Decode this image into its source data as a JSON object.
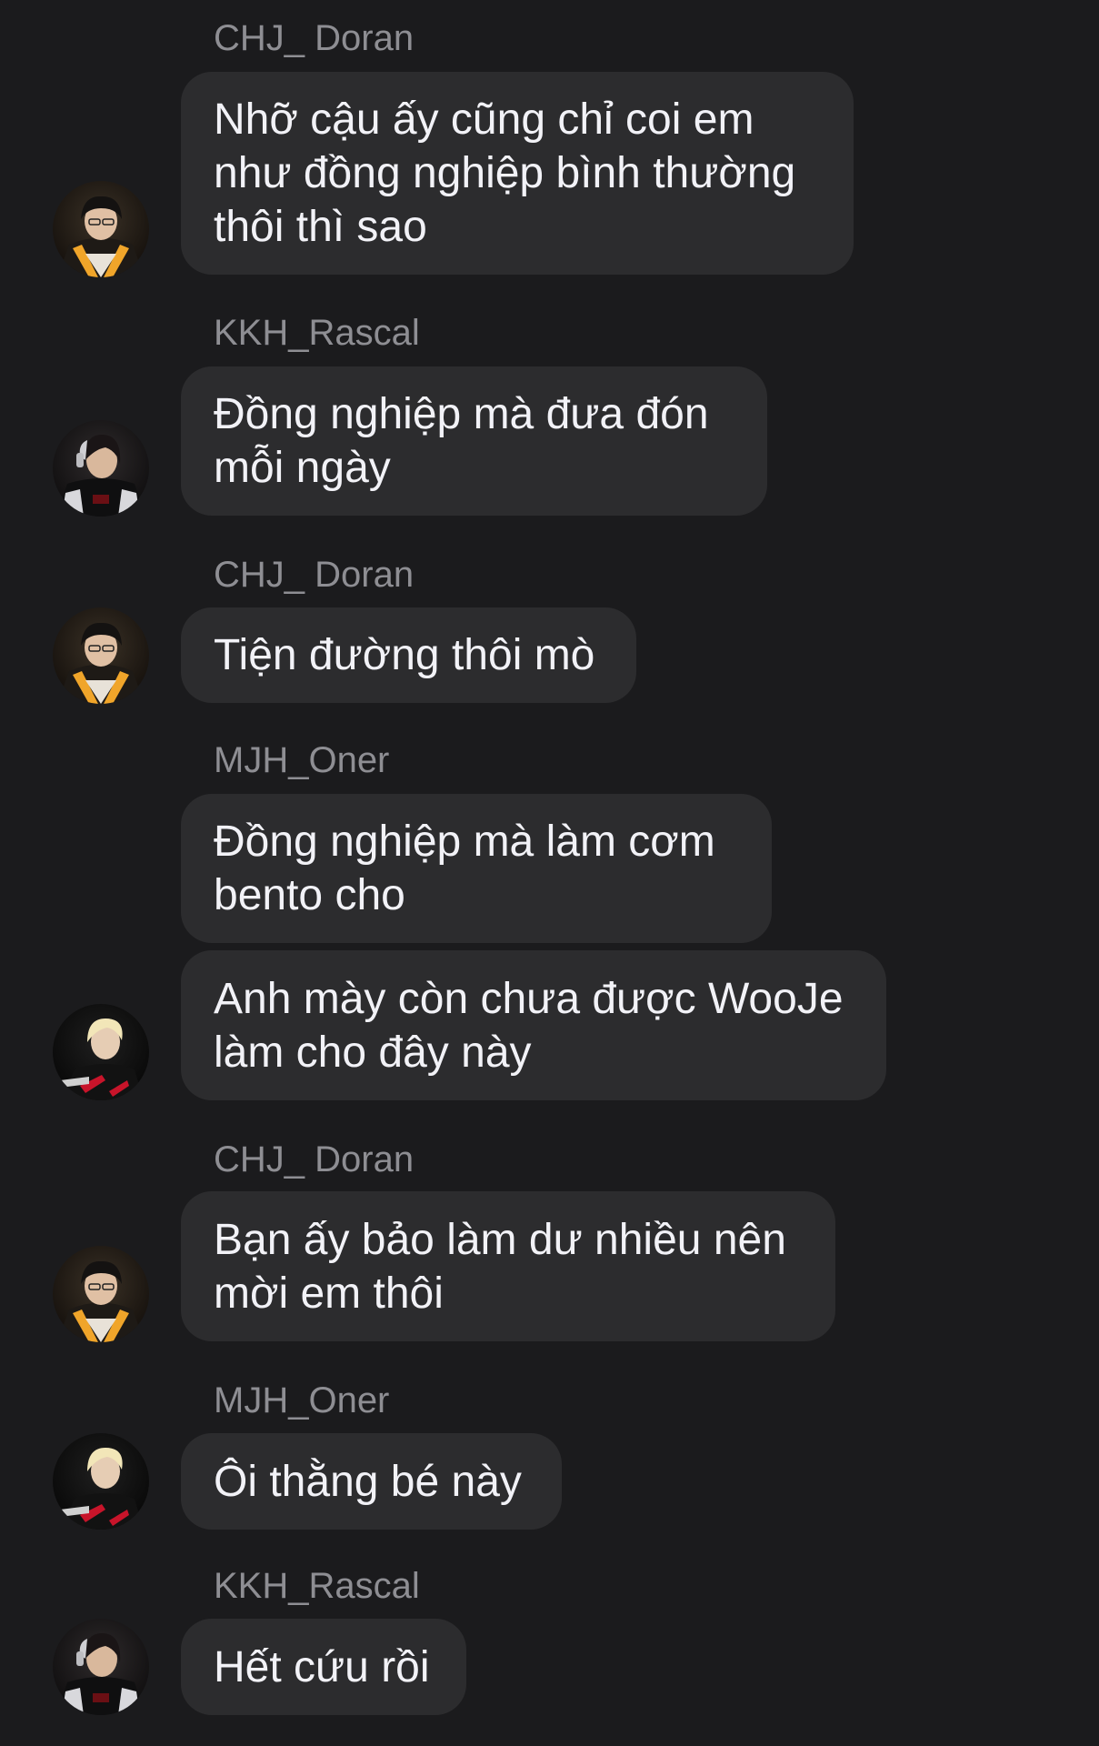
{
  "messages": [
    {
      "sender": "CHJ_ Doran",
      "lines": [
        "Nhỡ cậu ấy cũng chỉ coi em",
        "như đồng nghiệp bình thường",
        "thôi thì sao"
      ]
    },
    {
      "sender": "KKH_Rascal",
      "lines": [
        "Đồng nghiệp mà đưa đón",
        "mỗi ngày"
      ]
    },
    {
      "sender": "CHJ_ Doran",
      "lines": [
        "Tiện đường thôi mò"
      ]
    },
    {
      "sender": "MJH_Oner",
      "lines": [
        "Đồng nghiệp mà làm cơm",
        "bento cho"
      ]
    },
    {
      "sender": "",
      "lines": [
        "Anh mày còn chưa được WooJe",
        "làm cho đây này"
      ]
    },
    {
      "sender": "CHJ_ Doran",
      "lines": [
        "Bạn ấy bảo làm dư nhiều nên",
        "mời em thôi"
      ]
    },
    {
      "sender": "MJH_Oner",
      "lines": [
        "Ôi thằng bé này"
      ]
    },
    {
      "sender": "KKH_Rascal",
      "lines": [
        "Hết cứu rồi"
      ]
    }
  ],
  "avatars": [
    {
      "user": "CHJ_ Doran",
      "icon": "avatar-doran-photo"
    },
    {
      "user": "KKH_Rascal",
      "icon": "avatar-rascal-photo"
    },
    {
      "user": "MJH_Oner",
      "icon": "avatar-oner-photo"
    }
  ],
  "colors": {
    "background": "#1b1b1d",
    "bubble": "#2c2c2e",
    "message_text": "#f2f2f7",
    "sender_text": "#8e8e93"
  }
}
